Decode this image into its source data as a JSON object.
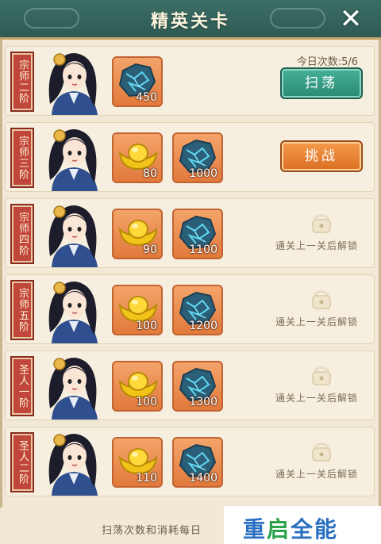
{
  "header": {
    "title": "精英关卡"
  },
  "today_count": "今日次数:5/6",
  "rows": [
    {
      "rank": "宗师二阶",
      "items": [
        {
          "type": "gem",
          "qty": "450"
        }
      ],
      "action": "sweep",
      "button": "扫荡"
    },
    {
      "rank": "宗师三阶",
      "items": [
        {
          "type": "gold",
          "qty": "80"
        },
        {
          "type": "gem",
          "qty": "1000"
        }
      ],
      "action": "challenge",
      "button": "挑战"
    },
    {
      "rank": "宗师四阶",
      "items": [
        {
          "type": "gold",
          "qty": "90"
        },
        {
          "type": "gem",
          "qty": "1100"
        }
      ],
      "action": "locked",
      "locked_text": "通关上一关后解锁"
    },
    {
      "rank": "宗师五阶",
      "items": [
        {
          "type": "gold",
          "qty": "100"
        },
        {
          "type": "gem",
          "qty": "1200"
        }
      ],
      "action": "locked",
      "locked_text": "通关上一关后解锁"
    },
    {
      "rank": "圣人一阶",
      "items": [
        {
          "type": "gold",
          "qty": "100"
        },
        {
          "type": "gem",
          "qty": "1300"
        }
      ],
      "action": "locked",
      "locked_text": "通关上一关后解锁"
    },
    {
      "rank": "圣人二阶",
      "items": [
        {
          "type": "gold",
          "qty": "110"
        },
        {
          "type": "gem",
          "qty": "1400"
        }
      ],
      "action": "locked",
      "locked_text": "通关上一关后解锁"
    }
  ],
  "footer_note": "扫荡次数和消耗每日",
  "watermark": {
    "part1": "重",
    "part2": "启",
    "part3": "全能"
  },
  "colors": {
    "header": "#2e5b54",
    "sweep": "#2a8a72",
    "challenge": "#db6f22",
    "rank_tag": "#c0453a",
    "item_bg": "#e1793b"
  }
}
